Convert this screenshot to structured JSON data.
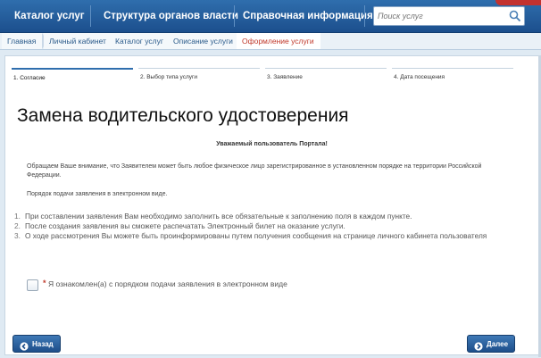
{
  "nav": {
    "items": [
      {
        "label": "Каталог услуг"
      },
      {
        "label": "Структура органов власти"
      },
      {
        "label": "Справочная информация"
      }
    ],
    "search_placeholder": "Поиск услуг",
    "search_icon": "search-icon"
  },
  "breadcrumbs": [
    {
      "label": "Главная"
    },
    {
      "label": "Личный кабинет"
    },
    {
      "label": "Каталог услуг"
    },
    {
      "label": "Описание услуги"
    },
    {
      "label": "Оформление услуги"
    }
  ],
  "steps": [
    {
      "label": "1. Согласие"
    },
    {
      "label": "2. Выбор типа услуги"
    },
    {
      "label": "3. Заявление"
    },
    {
      "label": "4. Дата посещения"
    }
  ],
  "active_step": 1,
  "page_title": "Замена водительского удостоверения",
  "greeting": "Уважаемый пользователь Портала!",
  "notice": "Обращаем Ваше внимание, что Заявителем может быть любое физическое лицо зарегистрированное в установленном порядке на территории Российской Федерации.",
  "procedure_title": "Порядок подачи заявления в электронном виде.",
  "rules": [
    {
      "num": "1.",
      "text": "При составлении заявления Вам необходимо заполнить все обязательные к заполнению поля в каждом пункте."
    },
    {
      "num": "2.",
      "text": "После создания заявления вы сможете распечатать Электронный билет на оказание услуги."
    },
    {
      "num": "3.",
      "text": "О ходе рассмотрения Вы можете быть проинформированы путем получения сообщения на странице личного кабинета пользователя"
    }
  ],
  "consent": {
    "required_mark": "*",
    "label": "Я ознакомлен(а) с порядком подачи заявления в электронном виде",
    "checked": false
  },
  "buttons": {
    "back": "Назад",
    "next": "Далее"
  },
  "colors": {
    "nav_bg": "#1f5592",
    "accent_red": "#c0392b",
    "button_bg": "#2a60a0"
  }
}
